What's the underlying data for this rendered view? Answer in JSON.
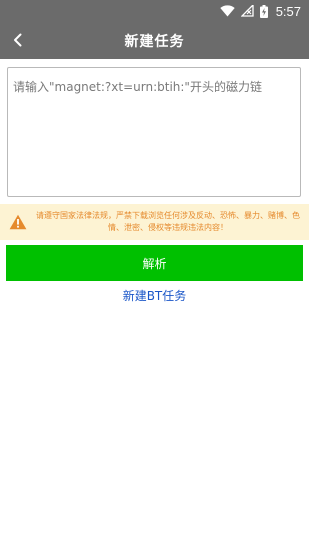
{
  "status_bar": {
    "time": "5:57",
    "icons": [
      "wifi-icon",
      "signal-off-icon",
      "battery-charging-icon"
    ]
  },
  "app_bar": {
    "title": "新建任务",
    "back_icon": "chevron-left-icon"
  },
  "magnet_input": {
    "value": "",
    "placeholder": "请输入\"magnet:?xt=urn:btih:\"开头的磁力链"
  },
  "notice": {
    "icon": "warning-icon",
    "text": "请遵守国家法律法规，严禁下载浏览任何涉及反动、恐怖、暴力、赌博、色情、泄密、侵权等违规违法内容！"
  },
  "parse_button": {
    "label": "解析"
  },
  "new_bt_link": {
    "label": "新建BT任务"
  },
  "colors": {
    "bar": "#6b6b6b",
    "notice_bg": "#fdf3d3",
    "notice_text": "#e58a2d",
    "primary_button": "#00c000",
    "link": "#1a56c8"
  }
}
